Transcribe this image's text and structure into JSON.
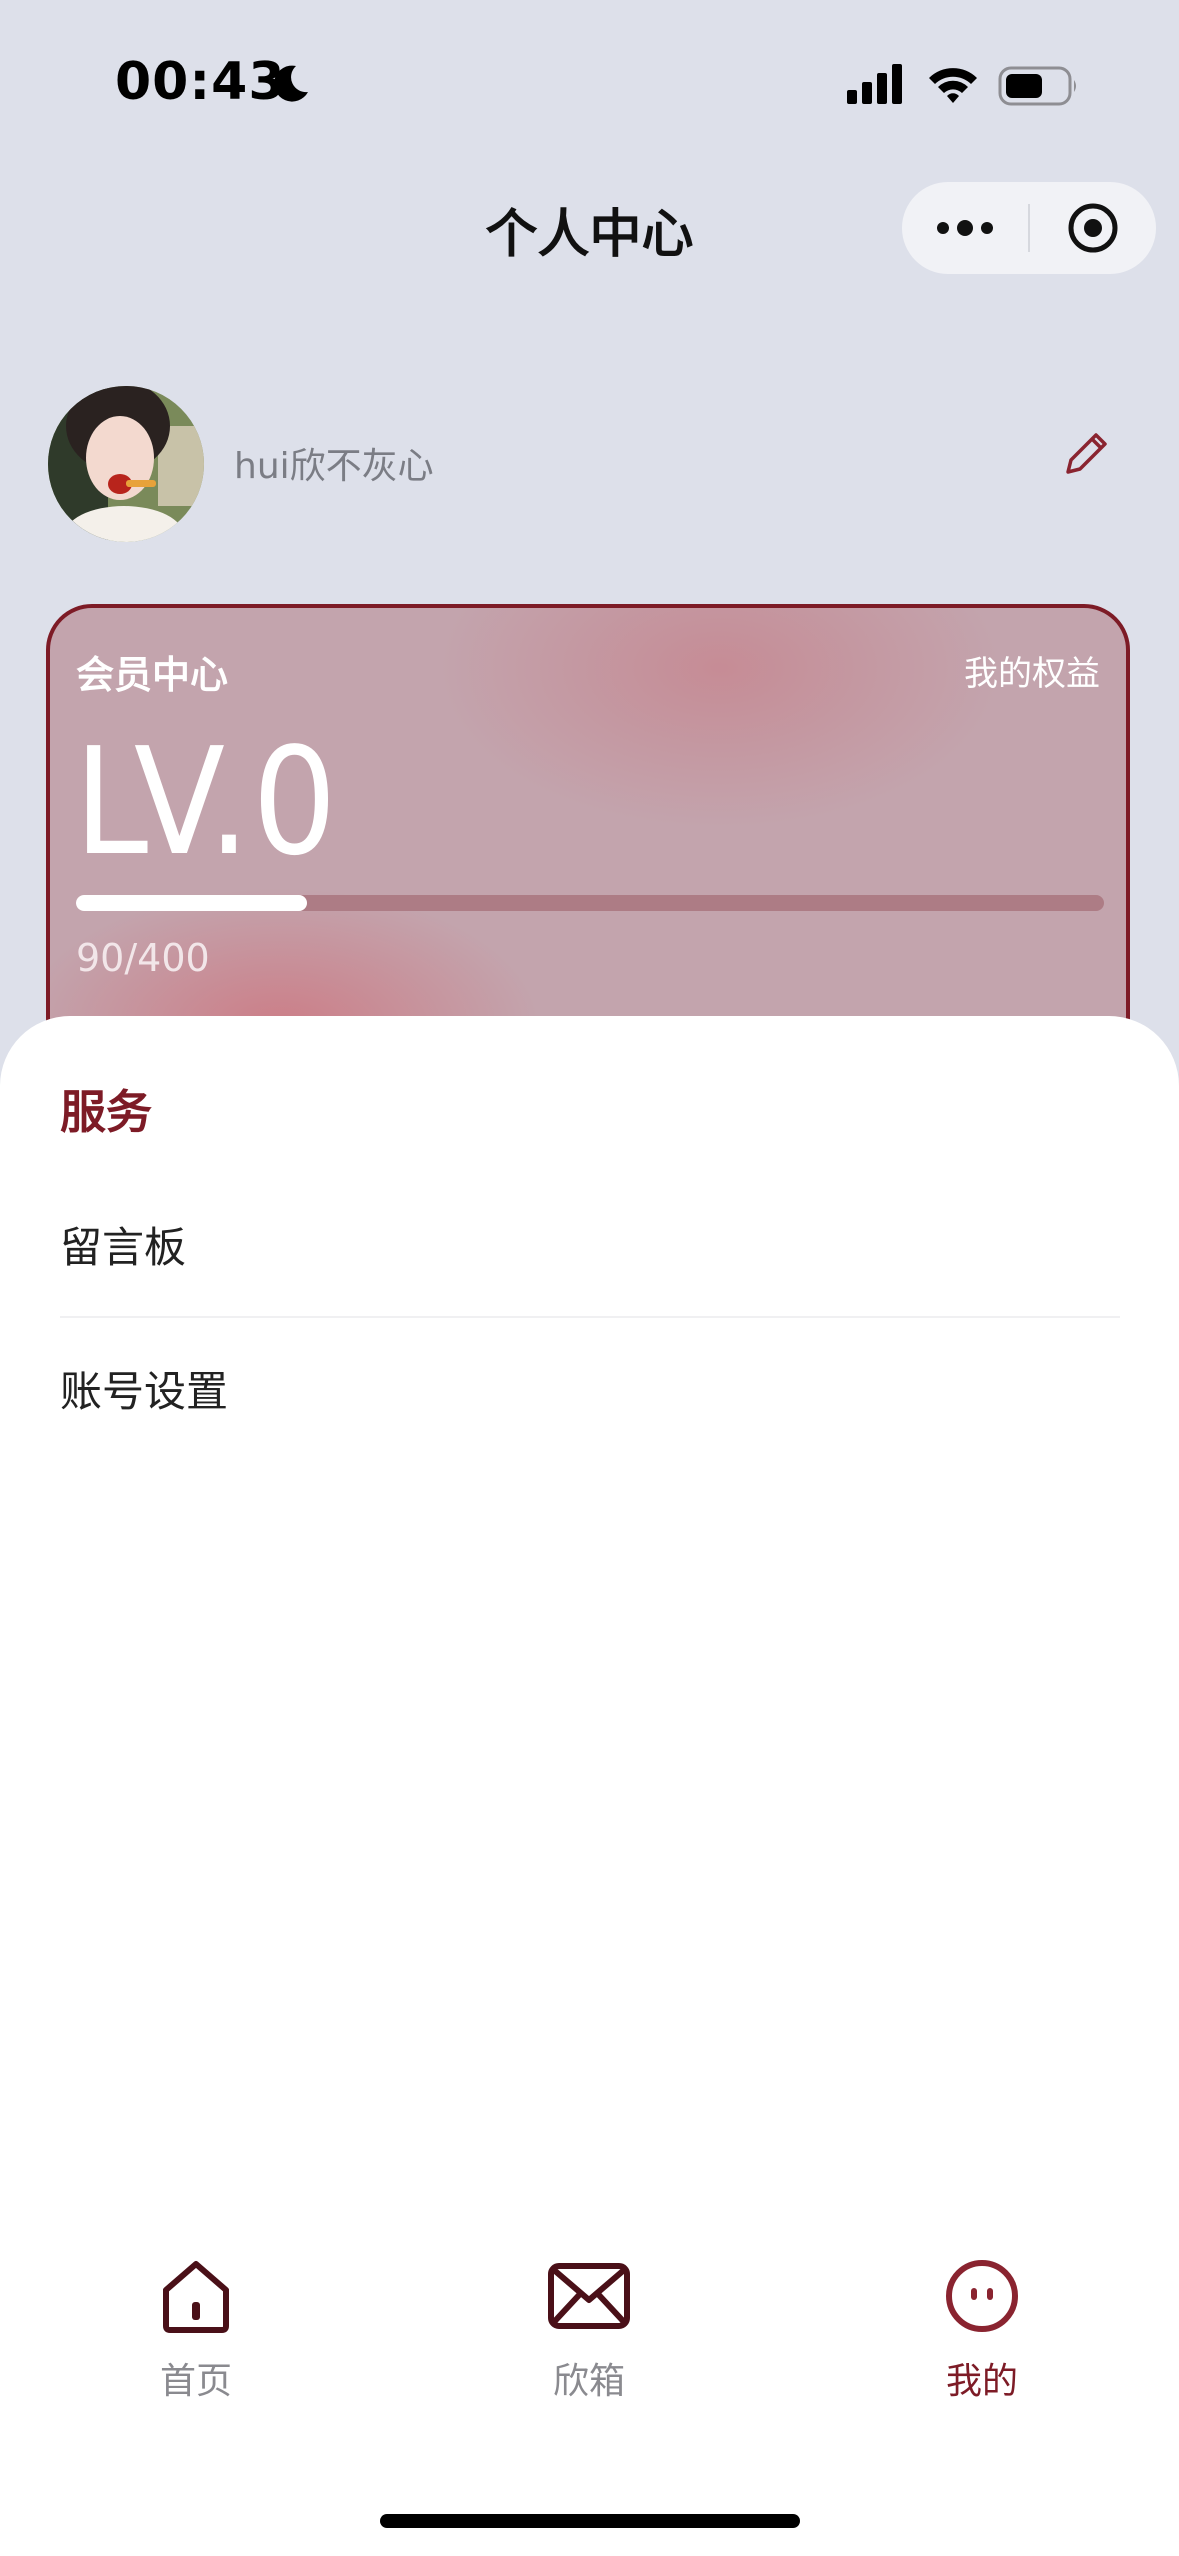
{
  "status_bar": {
    "time": "00:43",
    "icons": [
      "moon-icon",
      "cellular-signal-icon",
      "wifi-icon",
      "battery-icon"
    ]
  },
  "nav": {
    "title": "个人中心",
    "capsule_icons": [
      "more-icon",
      "close-target-icon"
    ]
  },
  "profile": {
    "username": "hui欣不灰心",
    "edit_icon": "pencil-icon"
  },
  "member_card": {
    "title": "会员中心",
    "benefits_link": "我的权益",
    "level": "LV.0",
    "progress_text": "90/400",
    "progress_fraction": 0.225
  },
  "services": {
    "title": "服务",
    "items": [
      {
        "label": "留言板"
      },
      {
        "label": "账号设置"
      }
    ]
  },
  "tab_bar": {
    "items": [
      {
        "label": "首页",
        "icon": "home-icon",
        "active": false
      },
      {
        "label": "欣箱",
        "icon": "mail-icon",
        "active": false
      },
      {
        "label": "我的",
        "icon": "profile-face-icon",
        "active": true
      }
    ]
  },
  "colors": {
    "accent": "#7d1b26",
    "background": "#dde0ea",
    "card": "#c3a4ad"
  }
}
